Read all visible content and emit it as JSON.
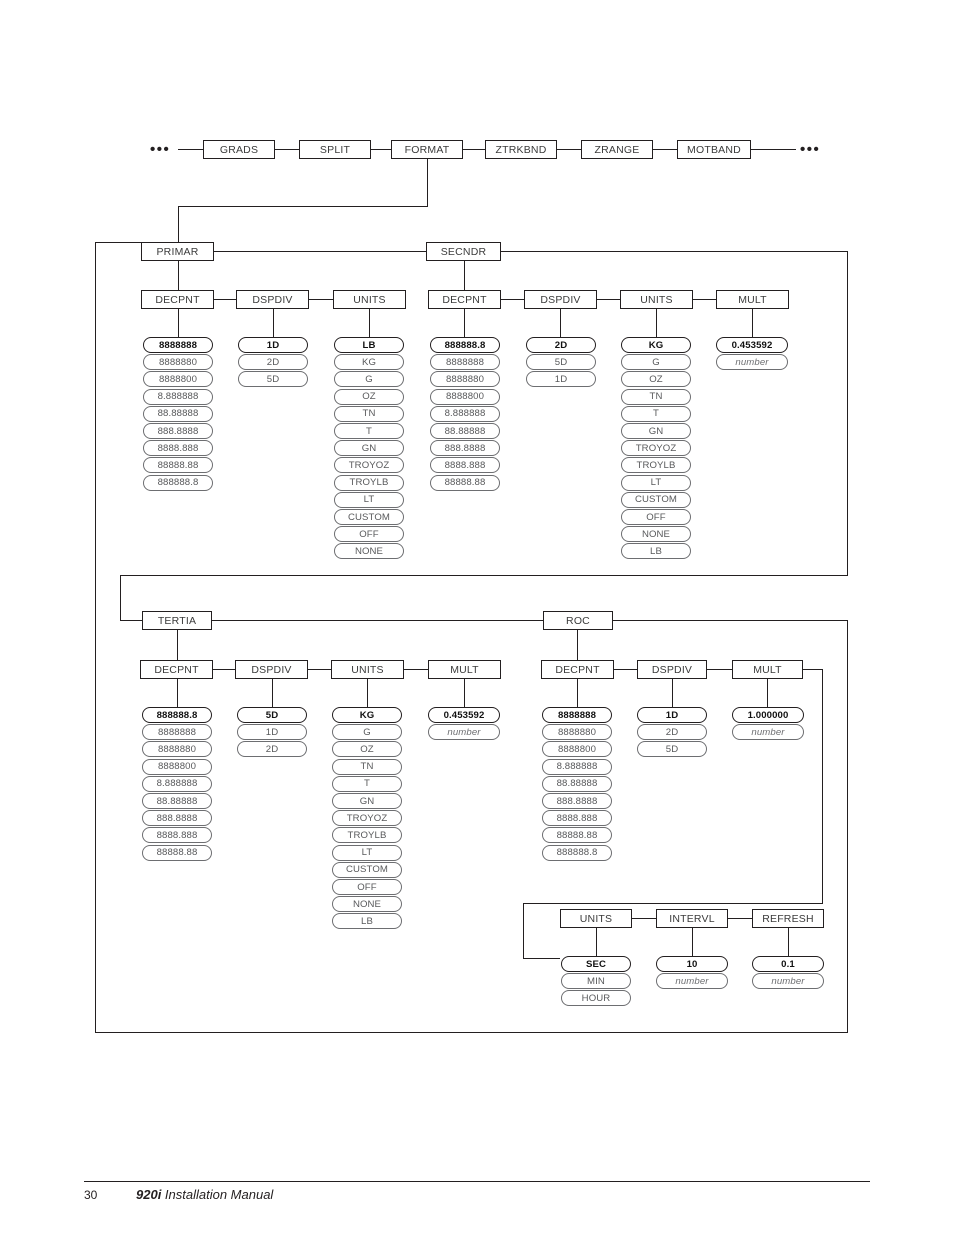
{
  "page": {
    "footer_page_number": "30",
    "footer_model": "920i",
    "footer_title": " Installation Manual",
    "ellipsis_left": "•••",
    "ellipsis_right": "•••"
  },
  "top_row": {
    "nodes": [
      {
        "label": "GRADS"
      },
      {
        "label": "SPLIT"
      },
      {
        "label": "FORMAT"
      },
      {
        "label": "ZTRKBND"
      },
      {
        "label": "ZRANGE"
      },
      {
        "label": "MOTBAND"
      }
    ]
  },
  "groups": [
    {
      "name": "PRIMAR",
      "label": "PRIMAR",
      "columns": [
        {
          "label": "DECPNT",
          "values": [
            "8888888",
            "8888880",
            "8888800",
            "8.888888",
            "88.88888",
            "888.8888",
            "8888.888",
            "88888.88",
            "888888.8"
          ]
        },
        {
          "label": "DSPDIV",
          "values": [
            "1D",
            "2D",
            "5D"
          ]
        },
        {
          "label": "UNITS",
          "values": [
            "LB",
            "KG",
            "G",
            "OZ",
            "TN",
            "T",
            "GN",
            "TROYOZ",
            "TROYLB",
            "LT",
            "CUSTOM",
            "OFF",
            "NONE"
          ]
        }
      ]
    },
    {
      "name": "SECNDR",
      "label": "SECNDR",
      "columns": [
        {
          "label": "DECPNT",
          "values": [
            "888888.8",
            "8888888",
            "8888880",
            "8888800",
            "8.888888",
            "88.88888",
            "888.8888",
            "8888.888",
            "88888.88"
          ]
        },
        {
          "label": "DSPDIV",
          "values": [
            "2D",
            "5D",
            "1D"
          ]
        },
        {
          "label": "UNITS",
          "values": [
            "KG",
            "G",
            "OZ",
            "TN",
            "T",
            "GN",
            "TROYOZ",
            "TROYLB",
            "LT",
            "CUSTOM",
            "OFF",
            "NONE",
            "LB"
          ]
        },
        {
          "label": "MULT",
          "values": [
            "0.453592",
            "number"
          ],
          "italic_from": 1
        }
      ]
    },
    {
      "name": "TERTIA",
      "label": "TERTIA",
      "columns": [
        {
          "label": "DECPNT",
          "values": [
            "888888.8",
            "8888888",
            "8888880",
            "8888800",
            "8.888888",
            "88.88888",
            "888.8888",
            "8888.888",
            "88888.88"
          ]
        },
        {
          "label": "DSPDIV",
          "values": [
            "5D",
            "1D",
            "2D"
          ]
        },
        {
          "label": "UNITS",
          "values": [
            "KG",
            "G",
            "OZ",
            "TN",
            "T",
            "GN",
            "TROYOZ",
            "TROYLB",
            "LT",
            "CUSTOM",
            "OFF",
            "NONE",
            "LB"
          ]
        },
        {
          "label": "MULT",
          "values": [
            "0.453592",
            "number"
          ],
          "italic_from": 1
        }
      ]
    },
    {
      "name": "ROC",
      "label": "ROC",
      "columns": [
        {
          "label": "DECPNT",
          "values": [
            "8888888",
            "8888880",
            "8888800",
            "8.888888",
            "88.88888",
            "888.8888",
            "8888.888",
            "88888.88",
            "888888.8"
          ]
        },
        {
          "label": "DSPDIV",
          "values": [
            "1D",
            "2D",
            "5D"
          ]
        },
        {
          "label": "MULT",
          "values": [
            "1.000000",
            "number"
          ],
          "italic_from": 1
        },
        {
          "label": "UNITS",
          "values": [
            "SEC",
            "MIN",
            "HOUR"
          ]
        },
        {
          "label": "INTERVL",
          "values": [
            "10",
            "number"
          ],
          "italic_from": 1
        },
        {
          "label": "REFRESH",
          "values": [
            "0.1",
            "number"
          ],
          "italic_from": 1
        }
      ]
    }
  ],
  "colors": {
    "line": "#58595b",
    "line_dark": "#231f20",
    "pill_border": "#6d6e71",
    "text": "#3b3b3b",
    "bold_text": "#111111"
  }
}
